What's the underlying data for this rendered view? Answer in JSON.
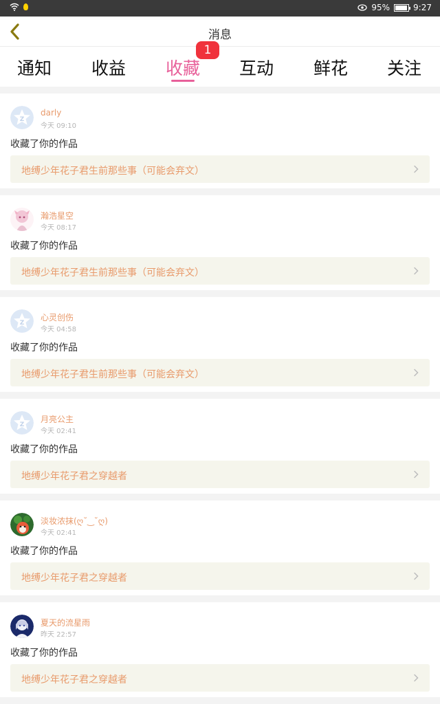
{
  "status_bar": {
    "battery_percent": "95%",
    "battery_level": 0.95,
    "time": "9:27"
  },
  "header": {
    "title": "消息"
  },
  "tabs": [
    {
      "label": "通知",
      "active": false
    },
    {
      "label": "收益",
      "active": false
    },
    {
      "label": "收藏",
      "active": true,
      "badge": "1"
    },
    {
      "label": "互动",
      "active": false
    },
    {
      "label": "鲜花",
      "active": false
    },
    {
      "label": "关注",
      "active": false
    }
  ],
  "colors": {
    "accent": "#e8609a",
    "badge": "#f0323c",
    "username": "#e89a6b",
    "work_bg": "#f5f5ec"
  },
  "notifications": [
    {
      "avatar": "default-star-avatar",
      "username": "darly",
      "time": "今天 09:10",
      "action": "收藏了你的作品",
      "work": "地缚少年花子君生前那些事（可能会弃文）"
    },
    {
      "avatar": "anime-girl-pink-avatar",
      "username": "瀚浩星空",
      "time": "今天 08:17",
      "action": "收藏了你的作品",
      "work": "地缚少年花子君生前那些事（可能会弃文）"
    },
    {
      "avatar": "default-star-avatar",
      "username": "心灵创伤",
      "time": "今天 04:58",
      "action": "收藏了你的作品",
      "work": "地缚少年花子君生前那些事（可能会弃文）"
    },
    {
      "avatar": "default-star-avatar",
      "username": "月亮公主",
      "time": "今天 02:41",
      "action": "收藏了你的作品",
      "work": "地缚少年花子君之穿越者"
    },
    {
      "avatar": "green-red-character-avatar",
      "username": "淡妆浓抹(ღ˘‿˘ღ)",
      "time": "今天 02:41",
      "action": "收藏了你的作品",
      "work": "地缚少年花子君之穿越者"
    },
    {
      "avatar": "anime-boy-blue-avatar",
      "username": "夏天的流星雨",
      "time": "昨天 22:57",
      "action": "收藏了你的作品",
      "work": "地缚少年花子君之穿越者"
    }
  ]
}
